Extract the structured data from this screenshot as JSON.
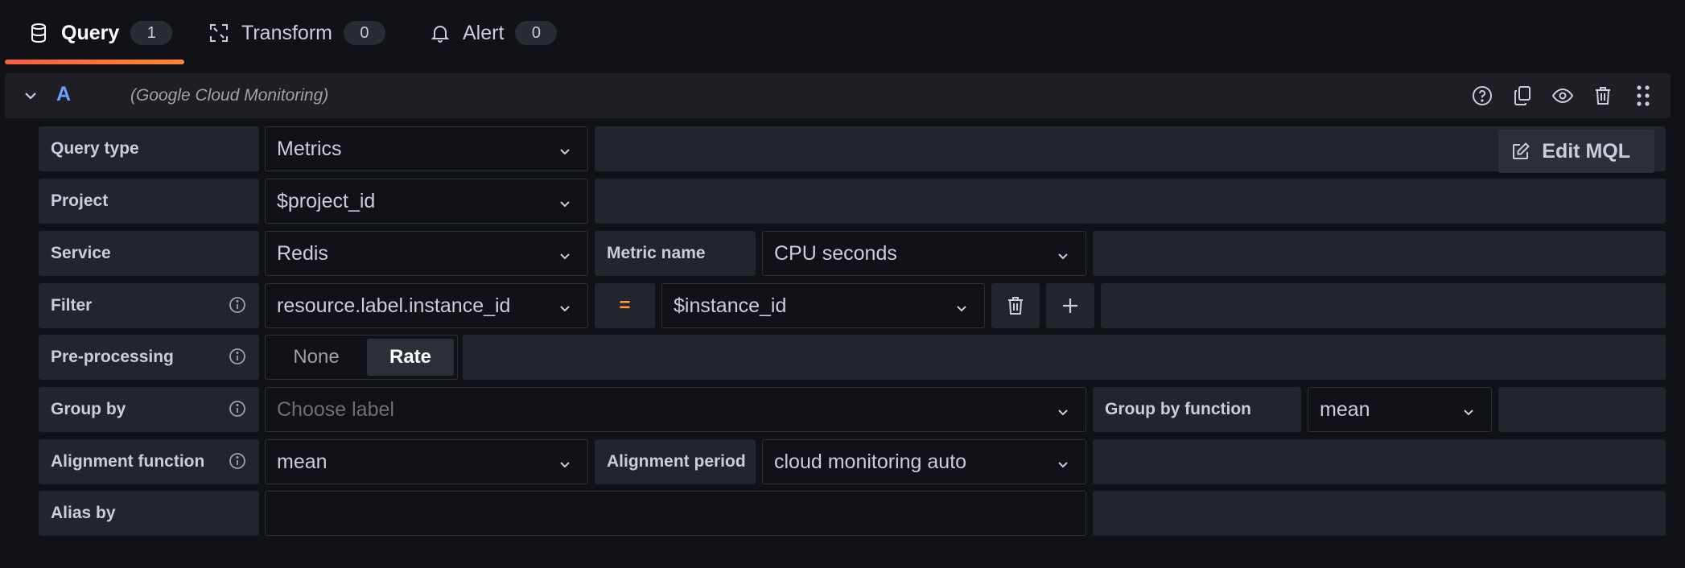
{
  "tabs": [
    {
      "label": "Query",
      "count": "1",
      "icon": "database-icon",
      "active": true
    },
    {
      "label": "Transform",
      "count": "0",
      "icon": "transform-icon",
      "active": false
    },
    {
      "label": "Alert",
      "count": "0",
      "icon": "bell-icon",
      "active": false
    }
  ],
  "query": {
    "ref_id": "A",
    "datasource": "(Google Cloud Monitoring)"
  },
  "form": {
    "query_type": {
      "label": "Query type",
      "value": "Metrics"
    },
    "edit_mql": "Edit MQL",
    "project": {
      "label": "Project",
      "value": "$project_id"
    },
    "service": {
      "label": "Service",
      "value": "Redis"
    },
    "metric_name": {
      "label": "Metric name",
      "value": "CPU seconds"
    },
    "filter": {
      "label": "Filter",
      "key": "resource.label.instance_id",
      "operator": "=",
      "value": "$instance_id"
    },
    "preprocessing": {
      "label": "Pre-processing",
      "options": [
        "None",
        "Rate"
      ],
      "selected": "Rate"
    },
    "group_by": {
      "label": "Group by",
      "placeholder": "Choose label"
    },
    "group_by_function": {
      "label": "Group by function",
      "value": "mean"
    },
    "alignment_function": {
      "label": "Alignment function",
      "value": "mean"
    },
    "alignment_period": {
      "label": "Alignment period",
      "value": "cloud monitoring auto"
    },
    "alias_by": {
      "label": "Alias by",
      "value": ""
    }
  },
  "colors": {
    "accent_gradient_start": "#f55f3e",
    "accent_gradient_end": "#ff8833",
    "ref_id": "#6e9fff",
    "operator": "#ff9830"
  }
}
